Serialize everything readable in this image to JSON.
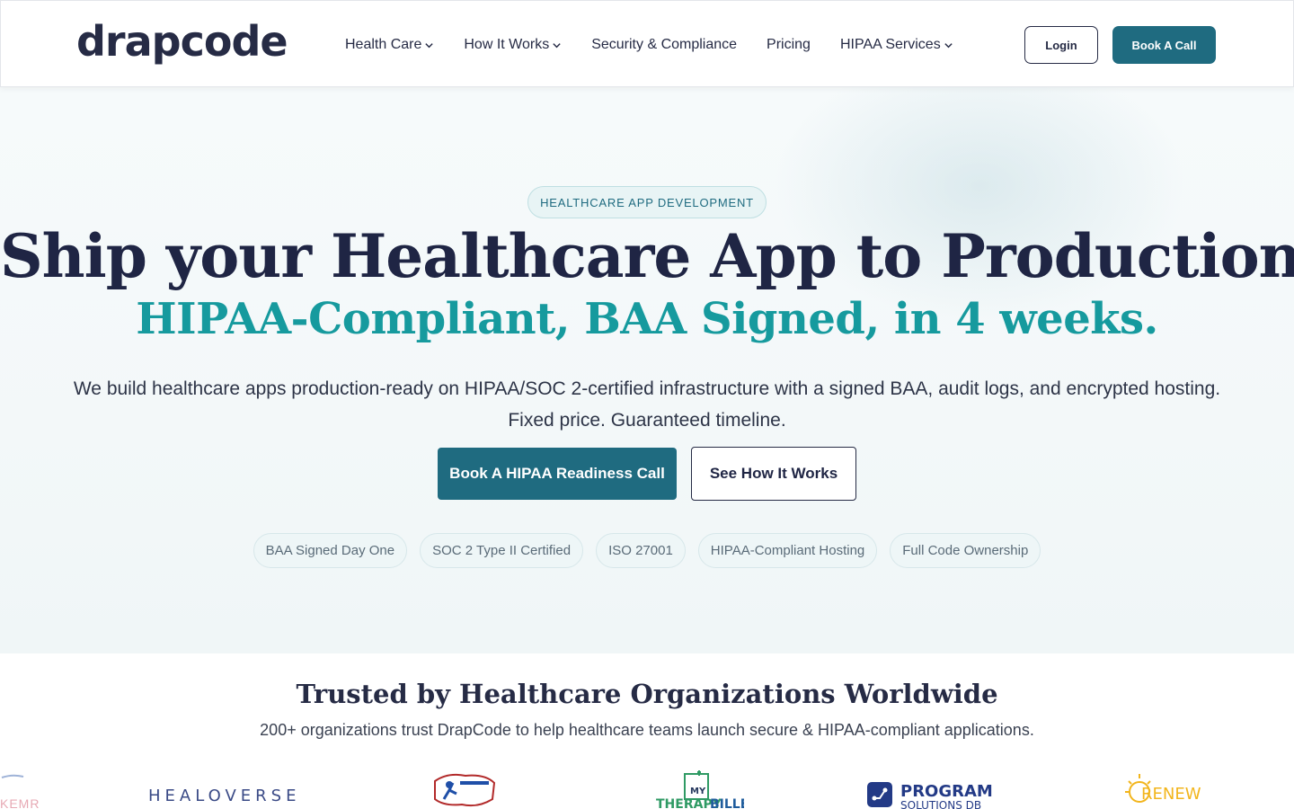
{
  "header": {
    "logo_text": "drapcode",
    "nav": [
      {
        "label": "Health Care",
        "has_dropdown": true
      },
      {
        "label": "How It Works",
        "has_dropdown": true
      },
      {
        "label": "Security & Compliance",
        "has_dropdown": false
      },
      {
        "label": "Pricing",
        "has_dropdown": false
      },
      {
        "label": "HIPAA Services",
        "has_dropdown": true
      }
    ],
    "login_label": "Login",
    "book_label": "Book A Call"
  },
  "hero": {
    "badge": "HEALTHCARE APP DEVELOPMENT",
    "title": "Ship your Healthcare App to Production",
    "subtitle": "HIPAA-Compliant, BAA Signed, in 4 weeks.",
    "lead_line1": "We build healthcare apps production-ready on HIPAA/SOC 2-certified infrastructure with a signed BAA, audit logs, and encrypted hosting.",
    "lead_line2": "Fixed price. Guaranteed timeline.",
    "cta_primary": "Book A HIPAA Readiness Call",
    "cta_secondary": "See How It Works",
    "pills": [
      "BAA Signed Day One",
      "SOC 2 Type II Certified",
      "ISO 27001",
      "HIPAA-Compliant Hosting",
      "Full Code Ownership"
    ]
  },
  "trusted": {
    "title": "Trusted by Healthcare Organizations Worldwide",
    "subtitle": "200+ organizations trust DrapCode to help healthcare teams launch secure & HIPAA-compliant applications.",
    "logos": [
      "KEMR",
      "HEALOVERSE",
      "MY THERAPY BILLER",
      "PROGRAM SOLUTIONS DB",
      "RENEW"
    ]
  },
  "colors": {
    "brand_dark": "#1f2544",
    "brand_teal": "#1f6b80",
    "accent_teal": "#169a9e"
  }
}
